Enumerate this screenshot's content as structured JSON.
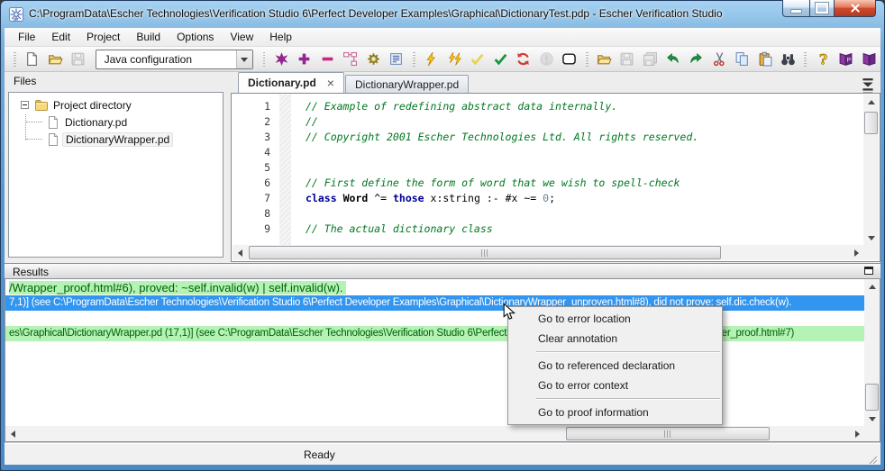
{
  "window": {
    "title": "C:\\ProgramData\\Escher Technologies\\Verification Studio 6\\Perfect Developer Examples\\Graphical\\DictionaryTest.pdp - Escher Verification Studio"
  },
  "menu": {
    "items": [
      "File",
      "Edit",
      "Project",
      "Build",
      "Options",
      "View",
      "Help"
    ]
  },
  "toolbar": {
    "configuration": "Java configuration",
    "buttons": [
      {
        "type": "grip"
      },
      {
        "type": "button",
        "name": "new-project-icon"
      },
      {
        "type": "button",
        "name": "open-project-icon"
      },
      {
        "type": "button",
        "name": "save-project-icon",
        "disabled": true
      },
      {
        "type": "combo"
      },
      {
        "type": "grip"
      },
      {
        "type": "button",
        "name": "add-new-file-icon"
      },
      {
        "type": "button",
        "name": "add-file-icon"
      },
      {
        "type": "button",
        "name": "remove-file-icon"
      },
      {
        "type": "button",
        "name": "project-structure-icon"
      },
      {
        "type": "button",
        "name": "project-settings-icon"
      },
      {
        "type": "button",
        "name": "view-report-icon"
      },
      {
        "type": "grip"
      },
      {
        "type": "button",
        "name": "build-icon"
      },
      {
        "type": "button",
        "name": "build-all-icon"
      },
      {
        "type": "button",
        "name": "check-icon"
      },
      {
        "type": "button",
        "name": "verify-icon"
      },
      {
        "type": "button",
        "name": "re-verify-icon"
      },
      {
        "type": "button",
        "name": "stop-icon",
        "disabled": true
      },
      {
        "type": "button",
        "name": "console-icon"
      },
      {
        "type": "grip"
      },
      {
        "type": "button",
        "name": "open-file-icon"
      },
      {
        "type": "button",
        "name": "save-file-icon",
        "disabled": true
      },
      {
        "type": "button",
        "name": "save-all-icon",
        "disabled": true
      },
      {
        "type": "button",
        "name": "undo-icon"
      },
      {
        "type": "button",
        "name": "redo-icon"
      },
      {
        "type": "button",
        "name": "cut-icon"
      },
      {
        "type": "button",
        "name": "copy-icon"
      },
      {
        "type": "button",
        "name": "paste-icon"
      },
      {
        "type": "button",
        "name": "find-icon"
      },
      {
        "type": "grip"
      },
      {
        "type": "button",
        "name": "help-icon"
      },
      {
        "type": "button",
        "name": "language-manual-icon"
      },
      {
        "type": "button",
        "name": "reference-manual-icon"
      }
    ]
  },
  "files_panel": {
    "title": "Files",
    "root_label": "Project directory",
    "files": [
      "Dictionary.pd",
      "DictionaryWrapper.pd"
    ]
  },
  "editor": {
    "tab_close_glyph": "×",
    "tabs": [
      {
        "label": "Dictionary.pd",
        "active": true,
        "closable": true
      },
      {
        "label": "DictionaryWrapper.pd",
        "active": false,
        "closable": false
      }
    ],
    "lines": [
      {
        "num": "1",
        "segments": [
          {
            "t": "// Example of redefining abstract data internally.",
            "c": "comment"
          }
        ]
      },
      {
        "num": "2",
        "segments": [
          {
            "t": "//",
            "c": "comment"
          }
        ]
      },
      {
        "num": "3",
        "segments": [
          {
            "t": "// Copyright 2001 Escher Technologies Ltd. All rights reserved.",
            "c": "comment"
          }
        ]
      },
      {
        "num": "4",
        "segments": []
      },
      {
        "num": "5",
        "segments": []
      },
      {
        "num": "6",
        "segments": [
          {
            "t": "// First define the form of word that we wish to spell-check",
            "c": "comment"
          }
        ]
      },
      {
        "num": "7",
        "segments": [
          {
            "t": "class",
            "c": "keyword"
          },
          {
            "t": " ",
            "c": "plain"
          },
          {
            "t": "Word",
            "c": "ident"
          },
          {
            "t": " ^= ",
            "c": "plain"
          },
          {
            "t": "those",
            "c": "keyword"
          },
          {
            "t": " x:string :- #x ~= ",
            "c": "plain"
          },
          {
            "t": "0",
            "c": "number"
          },
          {
            "t": ";",
            "c": "plain"
          }
        ]
      },
      {
        "num": "8",
        "segments": []
      },
      {
        "num": "9",
        "segments": [
          {
            "t": "// The actual dictionary class",
            "c": "comment"
          }
        ]
      }
    ]
  },
  "results": {
    "title": "Results",
    "lines": [
      {
        "style": "proved",
        "size": "large",
        "full_width": false,
        "text": "/Wrapper_proof.html#6), proved: ~self.invalid(w) | self.invalid(w)."
      },
      {
        "style": "selected",
        "full_width": true,
        "text": "7,1)] (see C:\\ProgramData\\Escher Technologies\\Verification Studio 6\\Perfect Developer Examples\\Graphical\\DictionaryWrapper_unproven.html#8), did not prove: self.dic.check(w)."
      },
      {
        "style": "blank",
        "full_width": false,
        "text": ""
      },
      {
        "style": "proved",
        "full_width": true,
        "text": "es\\Graphical\\DictionaryWrapper.pd (17,1)] (see C:\\ProgramData\\Escher Technologies\\Verification Studio 6\\Perfect Developer Examples\\Graphical\\DictionaryWrapper_proof.html#7)"
      }
    ]
  },
  "context_menu": {
    "items": [
      {
        "label": "Go to error location"
      },
      {
        "label": "Clear annotation"
      },
      {
        "separator": true
      },
      {
        "label": "Go to referenced declaration"
      },
      {
        "label": "Go to error context"
      },
      {
        "separator": true
      },
      {
        "label": "Go to proof information"
      }
    ]
  },
  "status_bar": {
    "text": "Ready"
  },
  "colors": {
    "selection_bg": "#3296f0",
    "proved_bg": "#b5f2b5",
    "proved_text": "#00600a",
    "comment_text": "#007820",
    "keyword_text": "#000096",
    "titlebar_blue": "#5795cd"
  }
}
